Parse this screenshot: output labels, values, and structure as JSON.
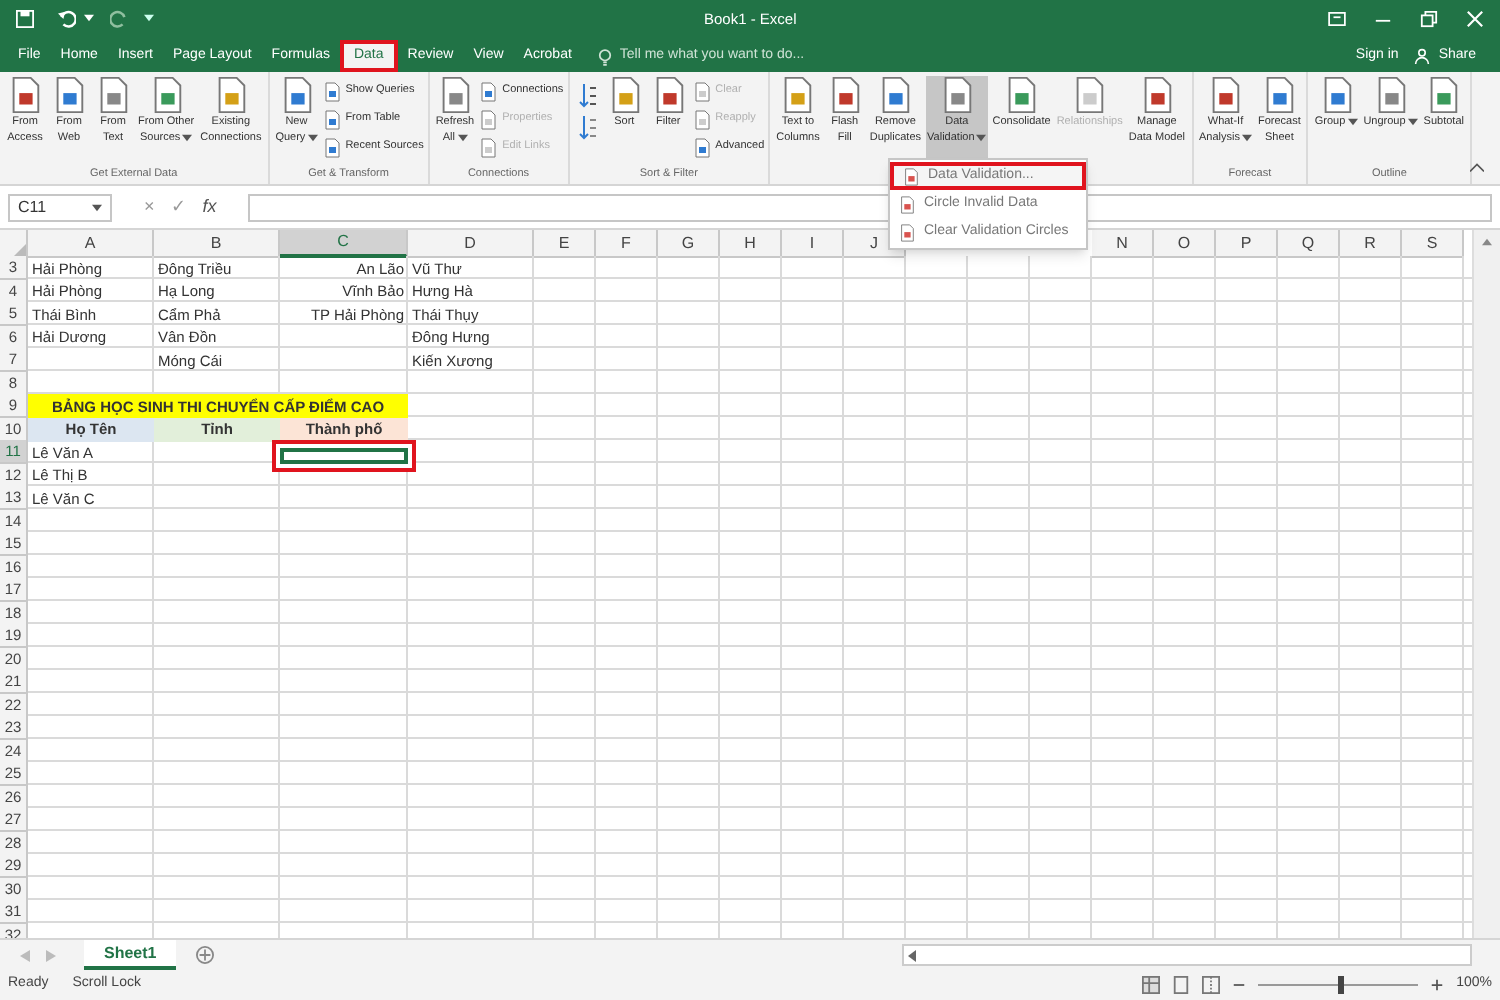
{
  "window": {
    "title": "Book1 - Excel"
  },
  "tabs": [
    {
      "label": "File",
      "selected": false,
      "highlight_box": false
    },
    {
      "label": "Home",
      "selected": false,
      "highlight_box": false
    },
    {
      "label": "Insert",
      "selected": false,
      "highlight_box": false
    },
    {
      "label": "Page Layout",
      "selected": false,
      "highlight_box": false
    },
    {
      "label": "Formulas",
      "selected": false,
      "highlight_box": false
    },
    {
      "label": "Data",
      "selected": true,
      "highlight_box": true
    },
    {
      "label": "Review",
      "selected": false,
      "highlight_box": false
    },
    {
      "label": "View",
      "selected": false,
      "highlight_box": false
    },
    {
      "label": "Acrobat",
      "selected": false,
      "highlight_box": false
    }
  ],
  "tell_me": {
    "placeholder": "Tell me what you want to do..."
  },
  "account": {
    "sign_in": "Sign in",
    "share": "Share"
  },
  "ribbon": {
    "groups": [
      {
        "label": "Get External Data",
        "items": [
          {
            "kind": "large",
            "lines": [
              "From",
              "Access"
            ],
            "dropdown": false,
            "disabled": false,
            "pressed": false
          },
          {
            "kind": "large",
            "lines": [
              "From",
              "Web"
            ],
            "dropdown": false,
            "disabled": false,
            "pressed": false
          },
          {
            "kind": "large",
            "lines": [
              "From",
              "Text"
            ],
            "dropdown": false,
            "disabled": false,
            "pressed": false
          },
          {
            "kind": "large",
            "lines": [
              "From Other",
              "Sources"
            ],
            "dropdown": true,
            "disabled": false,
            "pressed": false
          },
          {
            "kind": "large",
            "lines": [
              "Existing",
              "Connections"
            ],
            "dropdown": false,
            "disabled": false,
            "pressed": false
          }
        ]
      },
      {
        "label": "Get & Transform",
        "items": [
          {
            "kind": "large",
            "lines": [
              "New",
              "Query"
            ],
            "dropdown": true,
            "disabled": false,
            "pressed": false
          },
          {
            "kind": "stack",
            "items": [
              {
                "label": "Show Queries",
                "disabled": false
              },
              {
                "label": "From Table",
                "disabled": false
              },
              {
                "label": "Recent Sources",
                "disabled": false
              }
            ]
          }
        ]
      },
      {
        "label": "Connections",
        "items": [
          {
            "kind": "large",
            "lines": [
              "Refresh",
              "All"
            ],
            "dropdown": true,
            "disabled": false,
            "pressed": false
          },
          {
            "kind": "stack",
            "items": [
              {
                "label": "Connections",
                "disabled": false
              },
              {
                "label": "Properties",
                "disabled": true
              },
              {
                "label": "Edit Links",
                "disabled": true
              }
            ]
          }
        ]
      },
      {
        "label": "Sort & Filter",
        "items": [
          {
            "kind": "sort_icons"
          },
          {
            "kind": "large",
            "lines": [
              "Sort"
            ],
            "dropdown": false,
            "disabled": false,
            "pressed": false
          },
          {
            "kind": "large",
            "lines": [
              "Filter"
            ],
            "dropdown": false,
            "disabled": false,
            "pressed": false
          },
          {
            "kind": "stack",
            "items": [
              {
                "label": "Clear",
                "disabled": true
              },
              {
                "label": "Reapply",
                "disabled": true
              },
              {
                "label": "Advanced",
                "disabled": false
              }
            ]
          }
        ]
      },
      {
        "items": [
          {
            "kind": "large",
            "lines": [
              "Text to",
              "Columns"
            ],
            "dropdown": false,
            "disabled": false,
            "pressed": false
          },
          {
            "kind": "large",
            "lines": [
              "Flash",
              "Fill"
            ],
            "dropdown": false,
            "disabled": false,
            "pressed": false
          },
          {
            "kind": "large",
            "lines": [
              "Remove",
              "Duplicates"
            ],
            "dropdown": false,
            "disabled": false,
            "pressed": false
          },
          {
            "kind": "large",
            "lines": [
              "Data",
              "Validation"
            ],
            "dropdown": true,
            "disabled": false,
            "pressed": true
          },
          {
            "kind": "large",
            "lines": [
              "Consolidate"
            ],
            "dropdown": false,
            "disabled": false,
            "pressed": false
          },
          {
            "kind": "large",
            "lines": [
              "Relationships"
            ],
            "dropdown": false,
            "disabled": true,
            "pressed": false
          },
          {
            "kind": "large",
            "lines": [
              "Manage",
              "Data Model"
            ],
            "dropdown": false,
            "disabled": false,
            "pressed": false
          }
        ]
      },
      {
        "label": "Forecast",
        "items": [
          {
            "kind": "large",
            "lines": [
              "What-If",
              "Analysis"
            ],
            "dropdown": true,
            "disabled": false,
            "pressed": false
          },
          {
            "kind": "large",
            "lines": [
              "Forecast",
              "Sheet"
            ],
            "dropdown": false,
            "disabled": false,
            "pressed": false
          }
        ]
      },
      {
        "label": "Outline",
        "items": [
          {
            "kind": "large",
            "lines": [
              "Group"
            ],
            "dropdown": true,
            "disabled": false,
            "pressed": false
          },
          {
            "kind": "large",
            "lines": [
              "Ungroup"
            ],
            "dropdown": true,
            "disabled": false,
            "pressed": false
          },
          {
            "kind": "large",
            "lines": [
              "Subtotal"
            ],
            "dropdown": false,
            "disabled": false,
            "pressed": false
          }
        ]
      }
    ]
  },
  "menu": {
    "items": [
      {
        "label": "Data Validation...",
        "highlight_box": true
      },
      {
        "label": "Circle Invalid Data",
        "highlight_box": false
      },
      {
        "label": "Clear Validation Circles",
        "highlight_box": false
      }
    ]
  },
  "formula_bar": {
    "name_box": "C11",
    "buttons": [
      "×",
      "✓",
      "fx"
    ]
  },
  "sheet": {
    "selection": {
      "highlight_box": true
    },
    "columns": [
      {
        "label": "A",
        "selected": false
      },
      {
        "label": "B",
        "selected": false
      },
      {
        "label": "C",
        "selected": true
      },
      {
        "label": "D",
        "selected": false
      },
      {
        "label": "E",
        "selected": false
      },
      {
        "label": "F",
        "selected": false
      },
      {
        "label": "G",
        "selected": false
      },
      {
        "label": "H",
        "selected": false
      },
      {
        "label": "I",
        "selected": false
      },
      {
        "label": "J",
        "selected": false
      },
      {},
      {},
      {},
      {
        "label": "N",
        "selected": false
      },
      {
        "label": "O",
        "selected": false
      },
      {
        "label": "P",
        "selected": false
      },
      {
        "label": "Q",
        "selected": false
      },
      {
        "label": "R",
        "selected": false
      },
      {
        "label": "S",
        "selected": false
      }
    ],
    "rows": [
      {
        "number": "3",
        "selected": false,
        "cells": [
          "Hải Phòng",
          "Đông Triều",
          {
            "text": "An Lão",
            "right_aligned": true
          },
          "Vũ Thư"
        ]
      },
      {
        "number": "4",
        "selected": false,
        "cells": [
          "Hải Phòng",
          "Hạ Long",
          {
            "text": "Vĩnh Bảo",
            "right_aligned": true
          },
          "Hưng Hà"
        ]
      },
      {
        "number": "5",
        "selected": false,
        "cells": [
          "Thái Bình",
          "Cẩm Phả",
          {
            "text": "TP Hải Phòng",
            "right_aligned": true
          },
          "Thái Thụy"
        ]
      },
      {
        "number": "6",
        "selected": false,
        "cells": [
          "Hải Dương",
          "Vân Đồn",
          null,
          "Đông Hưng"
        ]
      },
      {
        "number": "7",
        "selected": false,
        "cells": [
          null,
          "Móng Cái",
          null,
          "Kiến Xương"
        ]
      },
      {
        "number": "8",
        "selected": false
      },
      {
        "number": "9",
        "selected": false,
        "kind": "title",
        "cells": [
          {
            "text": "BẢNG HỌC SINH THI CHUYỂN CẤP ĐIỂM CAO",
            "color": "#ffff00"
          }
        ]
      },
      {
        "number": "10",
        "selected": false,
        "kind": "header",
        "cells": [
          {
            "text": "Họ Tên",
            "color": "#dce6f1"
          },
          {
            "text": "Tỉnh",
            "color": "#e2efda"
          },
          {
            "text": "Thành phố",
            "color": "#fce4d6"
          }
        ]
      },
      {
        "number": "11",
        "selected": true,
        "cells": [
          "Lê Văn A"
        ]
      },
      {
        "number": "12",
        "selected": false,
        "cells": [
          "Lê Thị B"
        ]
      },
      {
        "number": "13",
        "selected": false,
        "cells": [
          "Lê Văn C"
        ]
      },
      {
        "number": "14",
        "selected": false
      },
      {
        "number": "15",
        "selected": false
      },
      {
        "number": "16",
        "selected": false
      },
      {
        "number": "17",
        "selected": false
      },
      {
        "number": "18",
        "selected": false
      },
      {
        "number": "19",
        "selected": false
      },
      {
        "number": "20",
        "selected": false
      },
      {
        "number": "21",
        "selected": false
      },
      {
        "number": "22",
        "selected": false
      },
      {
        "number": "23",
        "selected": false
      },
      {
        "number": "24",
        "selected": false
      },
      {
        "number": "25",
        "selected": false
      },
      {
        "number": "26",
        "selected": false
      },
      {
        "number": "27",
        "selected": false
      },
      {
        "number": "28",
        "selected": false
      },
      {
        "number": "29",
        "selected": false
      },
      {
        "number": "30",
        "selected": false
      },
      {
        "number": "31",
        "selected": false
      },
      {
        "number": "32",
        "selected": false
      }
    ]
  },
  "sheet_tabs": [
    {
      "label": "Sheet1",
      "selected": true
    }
  ],
  "status_bar": {
    "items": [
      "Ready",
      "Scroll Lock"
    ],
    "zoom": {
      "level": 0.5,
      "reading": "100%"
    }
  }
}
